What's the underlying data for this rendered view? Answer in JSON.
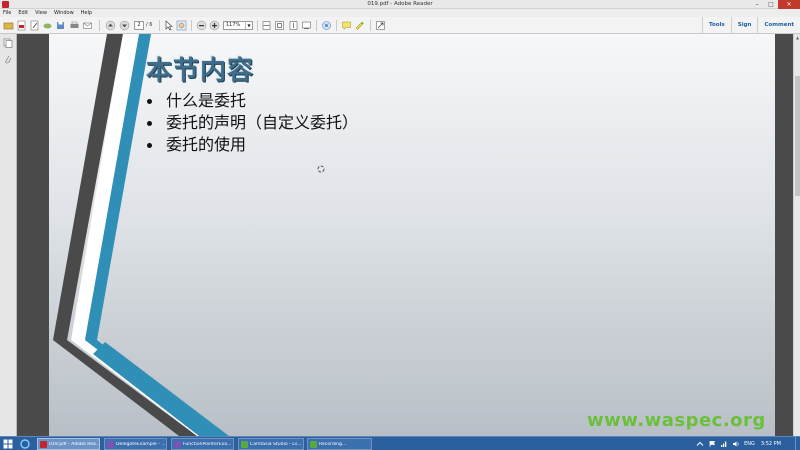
{
  "window": {
    "title": "019.pdf - Adobe Reader"
  },
  "menu": [
    "File",
    "Edit",
    "View",
    "Window",
    "Help"
  ],
  "toolbar": {
    "current_page": "2",
    "total_pages": "/ 6",
    "zoom": "117%",
    "right_tabs": [
      "Tools",
      "Sign",
      "Comment"
    ]
  },
  "slide": {
    "title": "本节内容",
    "bullets": [
      "什么是委托",
      "委托的声明（自定义委托）",
      "委托的使用"
    ],
    "watermark": "www.waspec.org"
  },
  "colors": {
    "accent_blue": "#2f8fb6",
    "dark_stripe": "#4a4a4a",
    "title_blue": "#3f6d8a",
    "watermark_green": "#6bc03a"
  },
  "taskbar": {
    "tasks": [
      {
        "label": "019.pdf - Adobe Rea...",
        "icon": "adobe-icon",
        "active": true
      },
      {
        "label": "DelegateExample - ...",
        "icon": "visual-studio-icon",
        "active": false
      },
      {
        "label": "FunctionPointerExa...",
        "icon": "visual-studio-icon",
        "active": false
      },
      {
        "label": "Camtasia Studio - Ls...",
        "icon": "camtasia-icon",
        "active": false
      },
      {
        "label": "Recording...",
        "icon": "camtasia-icon",
        "active": false
      }
    ],
    "language": "ENG",
    "clock": "3:52 PM"
  }
}
